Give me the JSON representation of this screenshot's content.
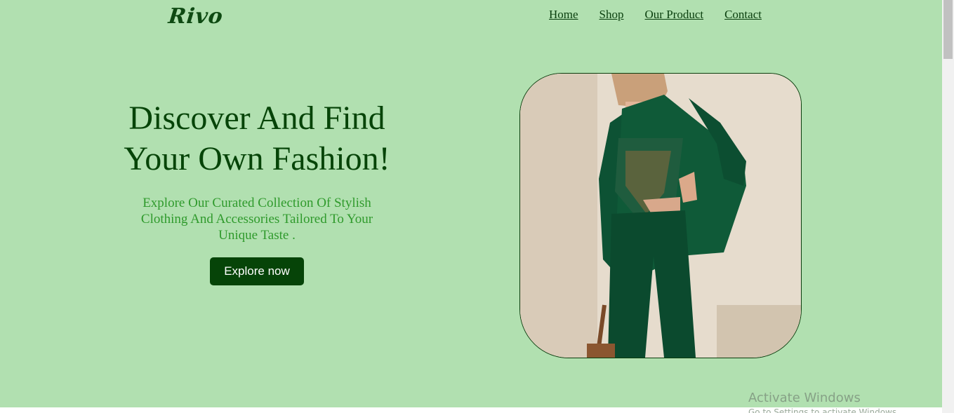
{
  "header": {
    "logo": "Rivo",
    "nav": [
      {
        "label": "Home"
      },
      {
        "label": "Shop"
      },
      {
        "label": "Our Product"
      },
      {
        "label": "Contact"
      }
    ]
  },
  "hero": {
    "title": "Discover And Find Your Own Fashion!",
    "subtitle": "Explore Our Curated Collection Of Stylish Clothing And Accessories Tailored To Your Unique Taste .",
    "cta_label": "Explore now",
    "image_subject": "model-in-green-suit"
  },
  "system": {
    "watermark_title": "Activate Windows",
    "watermark_subtitle": "Go to Settings to activate Windows."
  },
  "colors": {
    "background": "#b1e0b0",
    "heading": "#064408",
    "subtitle": "#2f9a2c",
    "button": "#064408",
    "suit": "#0d5234"
  }
}
